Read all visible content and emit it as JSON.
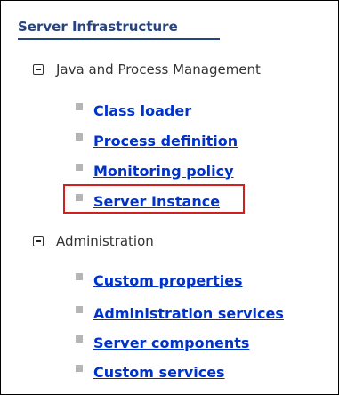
{
  "section": {
    "title": "Server Infrastructure"
  },
  "groups": [
    {
      "label": "Java and Process Management",
      "items": [
        "Class loader",
        "Process definition",
        "Monitoring policy",
        "Server Instance"
      ]
    },
    {
      "label": "Administration",
      "items": [
        "Custom properties",
        "Administration services",
        "Server components",
        "Custom services"
      ]
    }
  ],
  "colors": {
    "link": "#0033cc",
    "title": "#264480",
    "highlight": "#d41f1f"
  }
}
